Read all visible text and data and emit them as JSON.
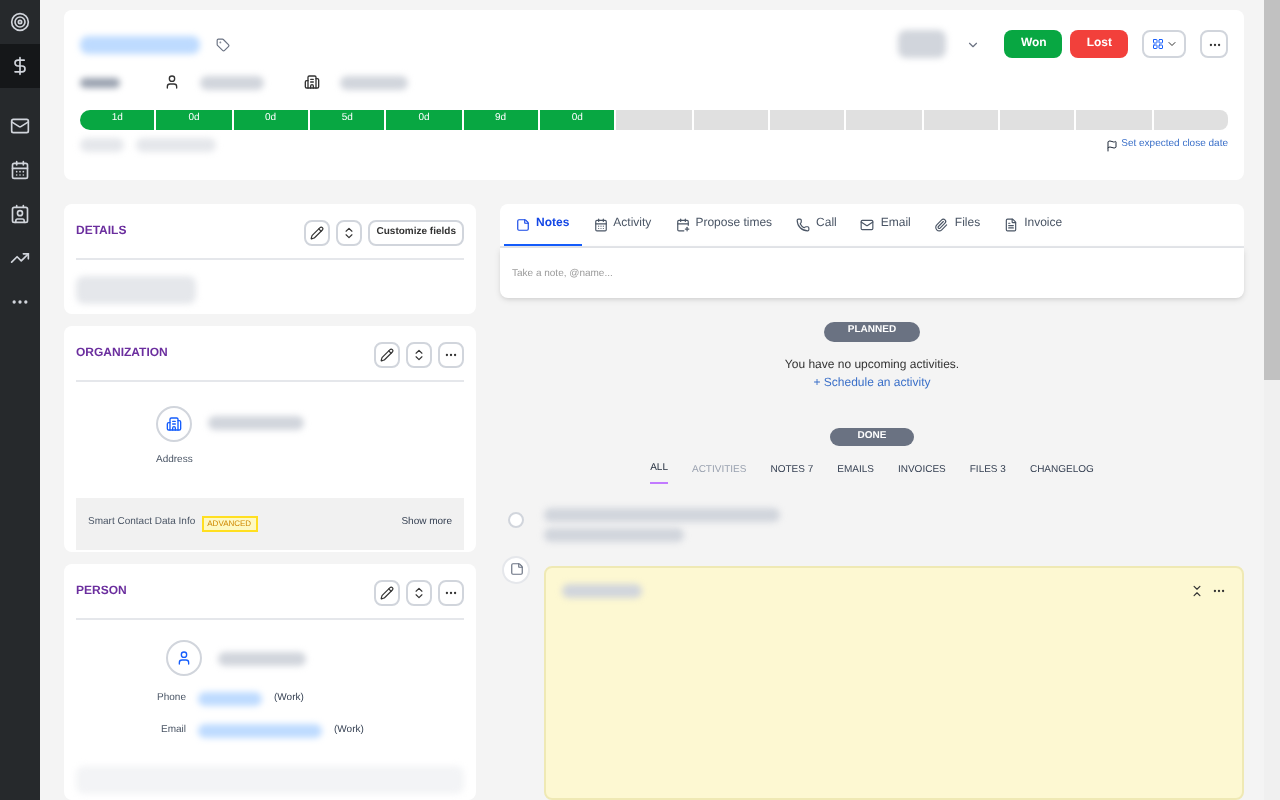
{
  "sidebar": {
    "items": [
      {
        "selected": false
      },
      {
        "selected": true
      },
      {
        "selected": false
      },
      {
        "selected": false
      },
      {
        "selected": false
      },
      {
        "selected": false
      },
      {
        "selected": false
      }
    ]
  },
  "header": {
    "won_button": "Won",
    "lost_button": "Lost",
    "close_date_link": "Set expected close date",
    "stages": [
      {
        "label": "1d",
        "done": true
      },
      {
        "label": "0d",
        "done": true
      },
      {
        "label": "0d",
        "done": true
      },
      {
        "label": "5d",
        "done": true
      },
      {
        "label": "0d",
        "done": true
      },
      {
        "label": "9d",
        "done": true
      },
      {
        "label": "0d",
        "done": true
      },
      {
        "done": false
      },
      {
        "done": false
      },
      {
        "done": false
      },
      {
        "done": false
      },
      {
        "done": false
      },
      {
        "done": false
      },
      {
        "done": false
      },
      {
        "done": false
      }
    ]
  },
  "details": {
    "title": "DETAILS",
    "customize_button": "Customize fields"
  },
  "organization": {
    "title": "ORGANIZATION",
    "address_label": "Address",
    "smart_contact": "Smart Contact Data Info",
    "badge": "ADVANCED",
    "show_more": "Show more"
  },
  "person": {
    "title": "PERSON",
    "fields": [
      {
        "label": "Phone",
        "type": "(Work)"
      },
      {
        "label": "Email",
        "type": "(Work)"
      }
    ]
  },
  "composer": {
    "tabs": [
      {
        "label": "Notes",
        "selected": true
      },
      {
        "label": "Activity",
        "selected": false
      },
      {
        "label": "Propose times",
        "selected": false
      },
      {
        "label": "Call",
        "selected": false
      },
      {
        "label": "Email",
        "selected": false
      },
      {
        "label": "Files",
        "selected": false
      },
      {
        "label": "Invoice",
        "selected": false
      }
    ],
    "placeholder": "Take a note, @name..."
  },
  "planned": {
    "label": "PLANNED",
    "message": "You have no upcoming activities.",
    "link": "+ Schedule an activity"
  },
  "done": {
    "label": "DONE",
    "filters": [
      {
        "label": "ALL",
        "selected": true,
        "disabled": false
      },
      {
        "label": "ACTIVITIES",
        "selected": false,
        "disabled": true
      },
      {
        "label": "NOTES 7",
        "selected": false,
        "disabled": false
      },
      {
        "label": "EMAILS",
        "selected": false,
        "disabled": false
      },
      {
        "label": "INVOICES",
        "selected": false,
        "disabled": false
      },
      {
        "label": "FILES 3",
        "selected": false,
        "disabled": false
      },
      {
        "label": "CHANGELOG",
        "selected": false,
        "disabled": false
      }
    ]
  }
}
